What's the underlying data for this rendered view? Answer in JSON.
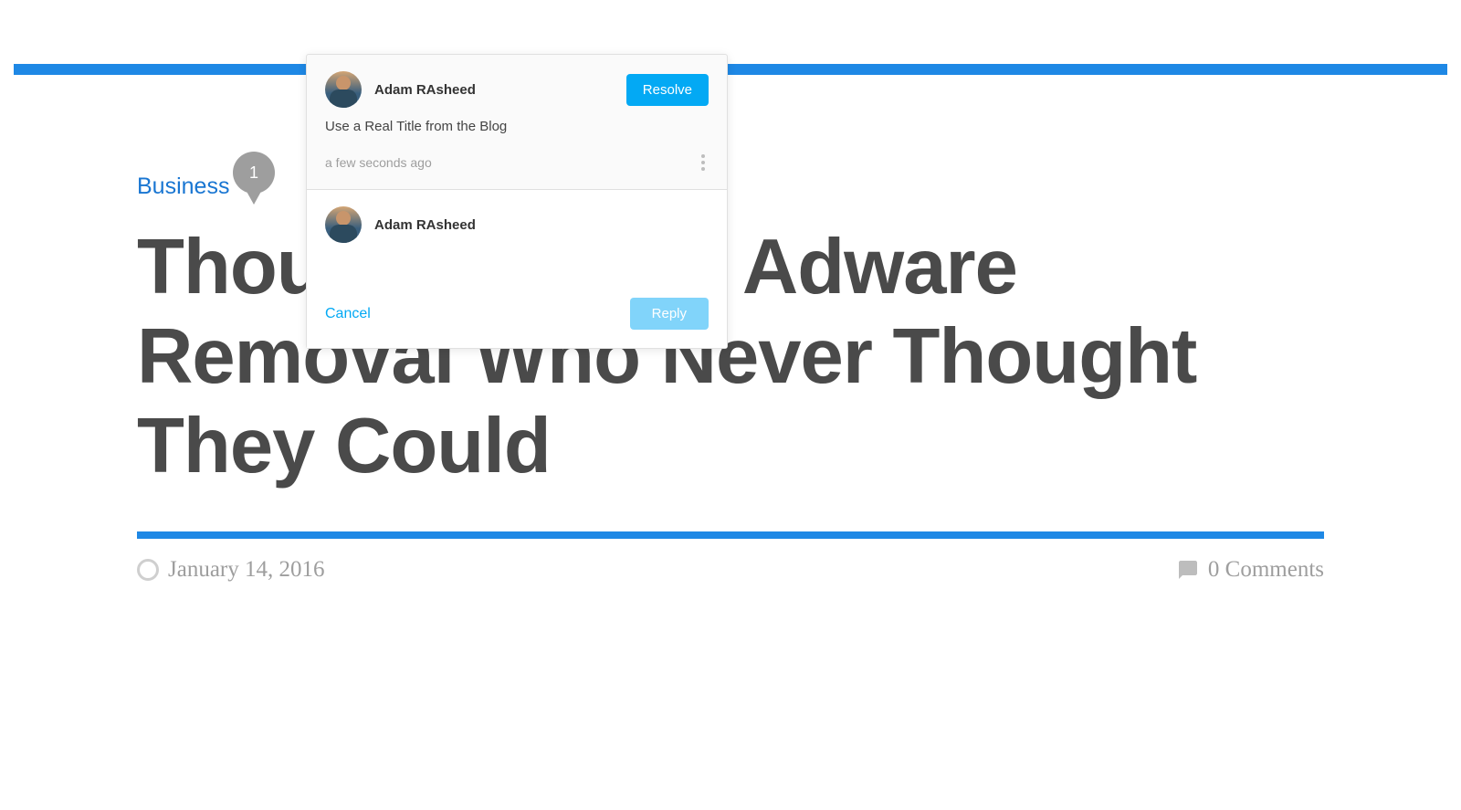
{
  "article": {
    "category": "Business",
    "title": "Thousands Now Adware Removal Who Never Thought They Could",
    "date": "January 14, 2016",
    "comments_label": "0 Comments"
  },
  "pin": {
    "count": "1"
  },
  "popover": {
    "comment": {
      "author": "Adam RAsheed",
      "resolve_label": "Resolve",
      "body": "Use a Real Title from the Blog",
      "timestamp": "a few seconds ago"
    },
    "reply": {
      "author": "Adam RAsheed",
      "cancel_label": "Cancel",
      "reply_label": "Reply"
    }
  }
}
